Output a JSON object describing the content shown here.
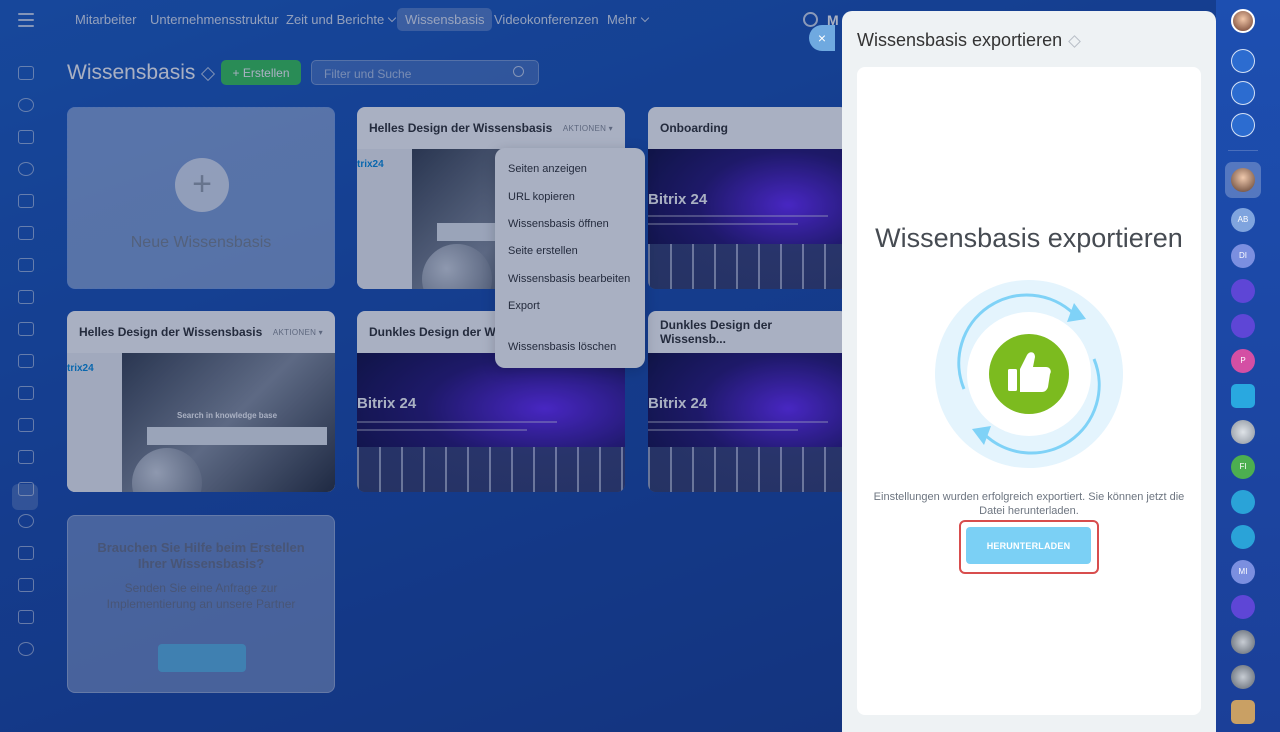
{
  "nav": {
    "items": [
      "Mitarbeiter",
      "Unternehmensstruktur",
      "Zeit und Berichte",
      "Wissensbasis",
      "Videokonferenzen",
      "Mehr"
    ],
    "search_letter": "M"
  },
  "page": {
    "title": "Wissensbasis",
    "create_label": "+ Erstellen",
    "search_placeholder": "Filter und Suche"
  },
  "new_card": {
    "plus": "+",
    "label": "Neue Wissensbasis"
  },
  "cards": [
    {
      "title": "Helles Design der Wissensbasis",
      "actions": "AKTIONEN"
    },
    {
      "title": "Onboarding"
    },
    {
      "title": "Helles Design der Wissensbasis",
      "actions": "AKTIONEN",
      "search_text": "Search in knowledge base"
    },
    {
      "title": "Dunkles Design der Wiss"
    },
    {
      "title": "Dunkles Design der Wissensb..."
    }
  ],
  "thumb_text": {
    "logo": "trix24",
    "brand": "Bitrix 24"
  },
  "help_card": {
    "title": "Brauchen Sie Hilfe beim Erstellen Ihrer Wissensbasis?",
    "text": "Senden Sie eine Anfrage zur Implementierung an unsere Partner"
  },
  "context_menu": {
    "items": [
      "Seiten anzeigen",
      "URL kopieren",
      "Wissensbasis öffnen",
      "Seite erstellen",
      "Wissensbasis bearbeiten",
      "Export",
      "Wissensbasis löschen"
    ]
  },
  "slider": {
    "title": "Wissensbasis exportieren",
    "heading": "Wissensbasis exportieren",
    "message": "Einstellungen wurden erfolgreich exportiert. Sie können jetzt die Datei herunterladen.",
    "download_label": "HERUNTERLADEN",
    "close": "×"
  },
  "rightbar": {
    "avatars": [
      "AB",
      "DI",
      "P",
      "FI",
      "MI"
    ]
  },
  "colors": {
    "accent_green": "#3bc85a",
    "thumbs_up_green": "#7cbb1f",
    "download_blue": "#7bd0f5",
    "highlight_red": "#d84d4d"
  }
}
